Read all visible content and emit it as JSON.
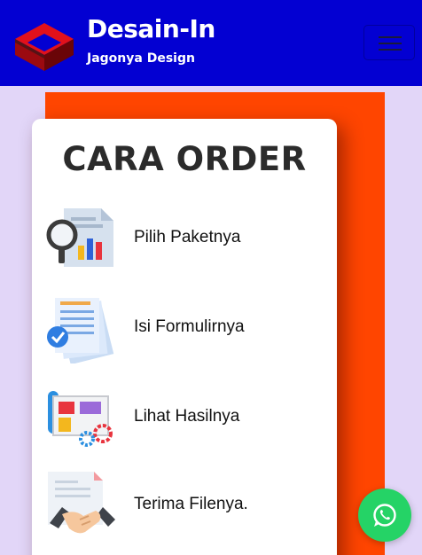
{
  "header": {
    "brand_title": "Desain-In",
    "brand_tagline": "Jagonya Design",
    "colors": {
      "background": "#0300d2",
      "text": "#ffffff"
    },
    "logo_icon": "cube-logo-icon",
    "menu_icon": "hamburger-menu-icon"
  },
  "main": {
    "accent_color": "#ff4500",
    "section_title": "CARA ORDER",
    "steps": [
      {
        "label": "Pilih Paketnya",
        "icon": "magnifier-report-icon"
      },
      {
        "label": "Isi Formulirnya",
        "icon": "form-documents-icon"
      },
      {
        "label": "Lihat Hasilnya",
        "icon": "design-board-icon"
      },
      {
        "label": "Terima Filenya.",
        "icon": "handshake-document-icon"
      }
    ]
  },
  "floating": {
    "whatsapp_icon": "whatsapp-icon",
    "whatsapp_color": "#25d366"
  }
}
